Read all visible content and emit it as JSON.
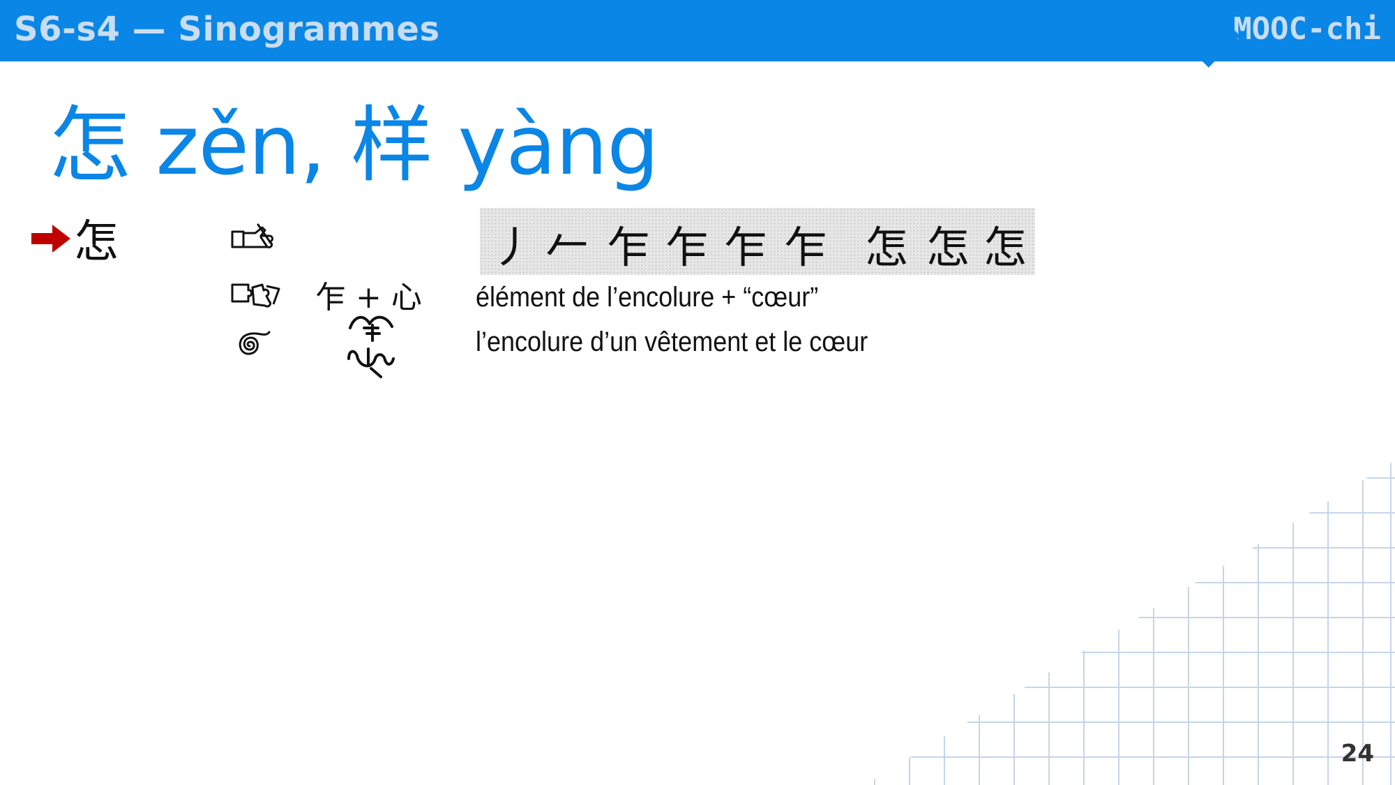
{
  "header": {
    "title": "S6-s4 — Sinogrammes",
    "brand": "MOOC-chi"
  },
  "slide": {
    "title": "怎 zěn, 样 yàng",
    "main_character": "怎",
    "stroke_order": [
      "丿",
      "𠂉",
      "乍",
      "乍",
      "乍",
      "乍",
      "怎",
      "怎",
      "怎"
    ],
    "composition": "乍 + 心",
    "meaning": "élément de l’encolure + “cœur”",
    "etymology": "l’encolure d’un vêtement et le cœur",
    "page_number": "24"
  },
  "icons": {
    "pointer": "red-arrow-icon",
    "writing": "writing-hand-icon",
    "components": "puzzle-pieces-icon",
    "etymology": "spiral-icon",
    "ancient_form": "ancient-glyph-icon"
  },
  "colors": {
    "header_bg": "#0a86e6",
    "header_text": "#c9ddf2",
    "title": "#0a86e6",
    "arrow": "#c00000",
    "grid_lines": "#c5d5e8"
  }
}
